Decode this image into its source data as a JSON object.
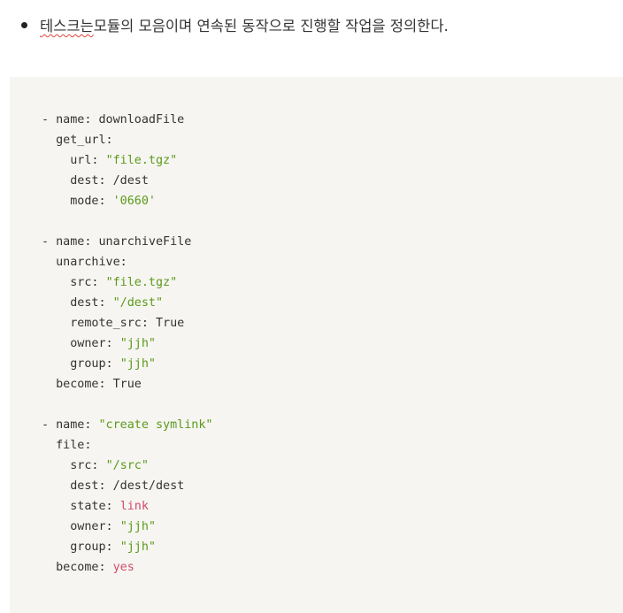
{
  "intro": {
    "underlined_word": "테스크는",
    "rest": " 모듈의 모음이며 연속된 동작으로 진행할 작업을 정의한다."
  },
  "code": {
    "language": "yaml",
    "lines": [
      [
        {
          "t": "- name: downloadFile",
          "k": "plain"
        }
      ],
      [
        {
          "t": "  get_url:",
          "k": "plain"
        }
      ],
      [
        {
          "t": "    url: ",
          "k": "plain"
        },
        {
          "t": "\"file.tgz\"",
          "k": "str"
        }
      ],
      [
        {
          "t": "    dest: /dest",
          "k": "plain"
        }
      ],
      [
        {
          "t": "    mode: ",
          "k": "plain"
        },
        {
          "t": "'0660'",
          "k": "str"
        }
      ],
      [],
      [
        {
          "t": "- name: unarchiveFile",
          "k": "plain"
        }
      ],
      [
        {
          "t": "  unarchive:",
          "k": "plain"
        }
      ],
      [
        {
          "t": "    src: ",
          "k": "plain"
        },
        {
          "t": "\"file.tgz\"",
          "k": "str"
        }
      ],
      [
        {
          "t": "    dest: ",
          "k": "plain"
        },
        {
          "t": "\"/dest\"",
          "k": "str"
        }
      ],
      [
        {
          "t": "    remote_src: True",
          "k": "plain"
        }
      ],
      [
        {
          "t": "    owner: ",
          "k": "plain"
        },
        {
          "t": "\"jjh\"",
          "k": "str"
        }
      ],
      [
        {
          "t": "    group: ",
          "k": "plain"
        },
        {
          "t": "\"jjh\"",
          "k": "str"
        }
      ],
      [
        {
          "t": "  become: True",
          "k": "plain"
        }
      ],
      [],
      [
        {
          "t": "- name: ",
          "k": "plain"
        },
        {
          "t": "\"create symlink\"",
          "k": "str"
        }
      ],
      [
        {
          "t": "  file:",
          "k": "plain"
        }
      ],
      [
        {
          "t": "    src: ",
          "k": "plain"
        },
        {
          "t": "\"/src\"",
          "k": "str"
        }
      ],
      [
        {
          "t": "    dest: /dest/dest",
          "k": "plain"
        }
      ],
      [
        {
          "t": "    state: ",
          "k": "plain"
        },
        {
          "t": "link",
          "k": "kw"
        }
      ],
      [
        {
          "t": "    owner: ",
          "k": "plain"
        },
        {
          "t": "\"jjh\"",
          "k": "str"
        }
      ],
      [
        {
          "t": "    group: ",
          "k": "plain"
        },
        {
          "t": "\"jjh\"",
          "k": "str"
        }
      ],
      [
        {
          "t": "  become: ",
          "k": "plain"
        },
        {
          "t": "yes",
          "k": "kw"
        }
      ]
    ]
  },
  "colors": {
    "code_background": "#f6f5f1",
    "string_token": "#5b9a1b",
    "keyword_token": "#d14b6a",
    "text": "#333333",
    "spellcheck_underline": "#e0443c"
  }
}
